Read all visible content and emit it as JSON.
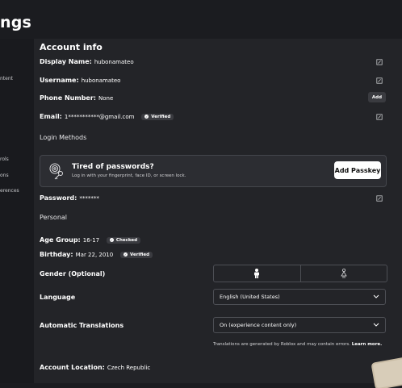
{
  "page": {
    "title": "ngs"
  },
  "sidebar": {
    "items": [
      {
        "label": "ntent"
      },
      {
        "label": "rols"
      },
      {
        "label": "ons"
      },
      {
        "label": "erences"
      }
    ]
  },
  "account": {
    "section_title": "Account info",
    "display_name": {
      "label": "Display Name:",
      "value": "hubonamateo"
    },
    "username": {
      "label": "Username:",
      "value": "hubonamateo"
    },
    "phone": {
      "label": "Phone Number:",
      "value": "None",
      "add_label": "Add"
    },
    "email": {
      "label": "Email:",
      "value": "1***********@gmail.com",
      "badge": "Verified"
    },
    "login_methods_title": "Login Methods",
    "passkey": {
      "title": "Tired of passwords?",
      "subtitle": "Log in with your fingerprint, face ID, or screen lock.",
      "button": "Add Passkey"
    },
    "password": {
      "label": "Password:",
      "value": "*******"
    }
  },
  "personal": {
    "section_title": "Personal",
    "age_group": {
      "label": "Age Group:",
      "value": "16-17",
      "badge": "Checked"
    },
    "birthday": {
      "label": "Birthday:",
      "value": "Mar 22, 2010",
      "badge": "Verified"
    },
    "gender": {
      "label": "Gender (Optional)"
    },
    "language": {
      "label": "Language",
      "selected": "English (United States)"
    },
    "translations": {
      "label": "Automatic Translations",
      "selected": "On (experience content only)",
      "note_text": "Translations are generated by Roblox and may contain errors.",
      "note_link": "Learn more."
    },
    "location": {
      "label": "Account Location:",
      "value": "Czech Republic"
    }
  }
}
